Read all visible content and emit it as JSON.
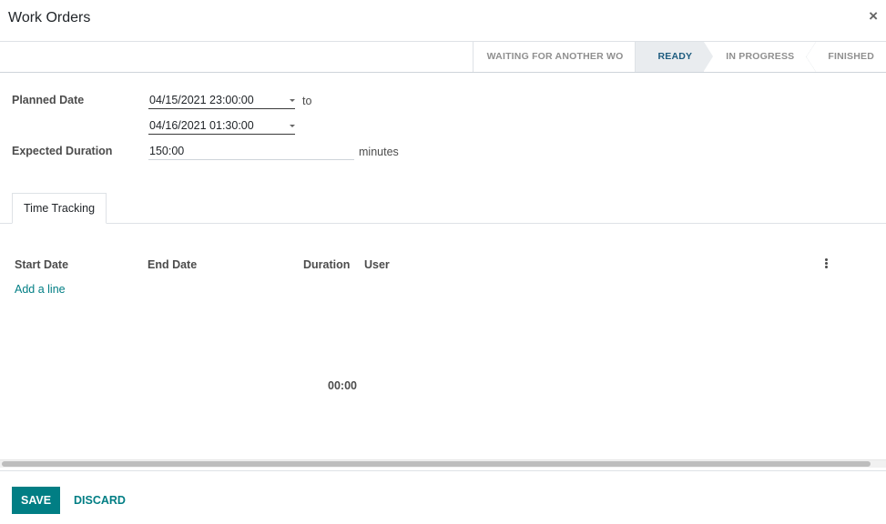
{
  "modal": {
    "title": "Work Orders",
    "close_glyph": "×"
  },
  "statusbar": {
    "steps": [
      {
        "label": "WAITING FOR ANOTHER WO",
        "active": false
      },
      {
        "label": "READY",
        "active": true
      },
      {
        "label": "IN PROGRESS",
        "active": false
      },
      {
        "label": "FINISHED",
        "active": false
      }
    ]
  },
  "form": {
    "planned_date_label": "Planned Date",
    "planned_start": "04/15/2021 23:00:00",
    "planned_end": "04/16/2021 01:30:00",
    "to_label": "to",
    "expected_duration_label": "Expected Duration",
    "expected_duration_value": "150:00",
    "duration_unit": "minutes"
  },
  "tabs": [
    {
      "label": "Time Tracking",
      "active": true
    }
  ],
  "time_tracking": {
    "columns": [
      "Start Date",
      "End Date",
      "Duration",
      "User"
    ],
    "rows": [],
    "add_line_label": "Add a line",
    "total_duration": "00:00"
  },
  "footer": {
    "save_label": "SAVE",
    "discard_label": "DISCARD"
  },
  "colors": {
    "accent": "#017e84",
    "active_status_text": "#1d5c7f",
    "active_status_bg": "#e9ecef"
  },
  "icons": {
    "close": "close-icon",
    "dropdown": "caret-down-icon",
    "column_options": "kebab-menu-icon"
  }
}
